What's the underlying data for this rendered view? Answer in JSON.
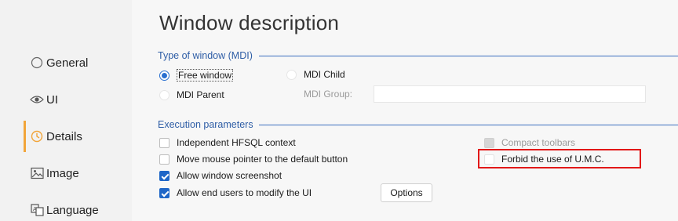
{
  "sidebar": {
    "items": [
      {
        "label": "General",
        "icon": "radio-circle-icon"
      },
      {
        "label": "UI",
        "icon": "eye-icon"
      },
      {
        "label": "Details",
        "icon": "clock-icon",
        "active": true
      },
      {
        "label": "Image",
        "icon": "image-icon"
      },
      {
        "label": "Language",
        "icon": "language-icon"
      }
    ]
  },
  "main": {
    "title": "Window description",
    "window_type": {
      "title": "Type of window (MDI)",
      "free_window": "Free window",
      "mdi_parent": "MDI Parent",
      "mdi_child": "MDI Child",
      "mdi_group_label": "MDI Group:",
      "mdi_group_value": ""
    },
    "execution": {
      "title": "Execution parameters",
      "independent_context": "Independent HFSQL context",
      "move_pointer": "Move mouse pointer to the default button",
      "allow_screenshot": "Allow window screenshot",
      "allow_modify_ui": "Allow end users to modify the UI",
      "options_button": "Options",
      "compact_toolbars": "Compact toolbars",
      "forbid_umc": "Forbid the use of U.M.C."
    }
  },
  "colors": {
    "accent": "#2a6fd0",
    "group_title": "#2f5ea6",
    "active_marker": "#f2a53a",
    "highlight": "#e21818"
  }
}
